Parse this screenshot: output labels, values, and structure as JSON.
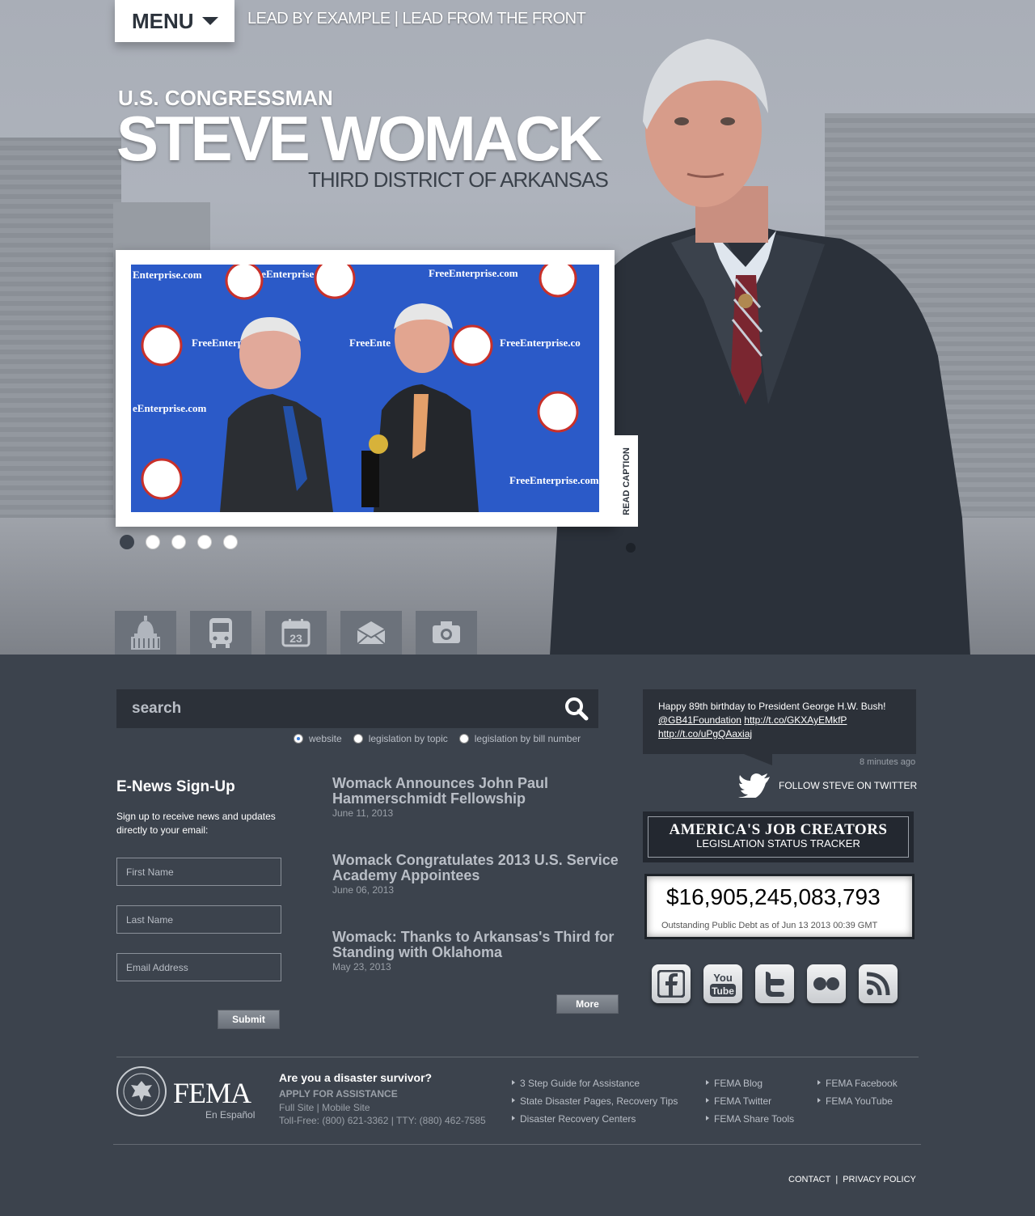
{
  "header": {
    "menu_label": "MENU",
    "tagline_left": "LEAD BY EXAMPLE",
    "tagline_sep": "|",
    "tagline_right": "LEAD FROM THE FRONT",
    "title_sub": "U.S. CONGRESSMAN",
    "title_name": "STEVE WOMACK",
    "title_district": "THIRD DISTRICT OF ARKANSAS"
  },
  "slideshow": {
    "caption_tab": "READ CAPTION",
    "backdrop_text": "FreeEnterprise.com",
    "dot_count": 5,
    "active_dot": 0
  },
  "quick_tabs": [
    {
      "icon": "capitol-icon"
    },
    {
      "icon": "bus-icon"
    },
    {
      "icon": "calendar-icon",
      "day": "23"
    },
    {
      "icon": "mail-icon"
    },
    {
      "icon": "camera-icon"
    }
  ],
  "search": {
    "placeholder": "search",
    "options": [
      "website",
      "legislation by topic",
      "legislation by bill number"
    ],
    "selected": "website"
  },
  "enews": {
    "title": "E-News Sign-Up",
    "description": "Sign up to receive news and updates directly to your email:",
    "first_name_placeholder": "First Name",
    "last_name_placeholder": "Last Name",
    "email_placeholder": "Email Address",
    "submit_label": "Submit"
  },
  "news": {
    "items": [
      {
        "title": "Womack Announces John Paul Hammerschmidt Fellowship",
        "date": "June 11, 2013"
      },
      {
        "title": "Womack Congratulates 2013 U.S. Service Academy Appointees",
        "date": "June 06, 2013"
      },
      {
        "title": "Womack: Thanks to Arkansas's Third for Standing with Oklahoma",
        "date": "May 23, 2013"
      }
    ],
    "more_label": "More"
  },
  "twitter": {
    "tweet_text": "Happy 89th birthday to President George H.W. Bush!",
    "mention": "@GB41Foundation",
    "link1": "http://t.co/GKXAyEMkfP",
    "link2": "http://t.co/uPgQAaxiaj",
    "time": "8 minutes ago",
    "follow_label": "FOLLOW STEVE ON TWITTER"
  },
  "jobs_banner": {
    "line1": "AMERICA'S JOB CREATORS",
    "line2": "LEGISLATION STATUS TRACKER"
  },
  "debt": {
    "value": "$16,905,245,083,793",
    "label": "Outstanding Public Debt as of Jun 13 2013 00:39 GMT"
  },
  "social": [
    "facebook-icon",
    "youtube-icon",
    "twitter-icon",
    "flickr-icon",
    "rss-icon"
  ],
  "fema": {
    "logo": "FEMA",
    "espanol": "En Español",
    "question": "Are you a disaster survivor?",
    "apply": "APPLY FOR ASSISTANCE",
    "sites": "Full Site | Mobile Site",
    "phone": "Toll-Free: (800) 621-3362 | TTY: (880) 462-7585",
    "col1": [
      "3 Step Guide for Assistance",
      "State Disaster Pages, Recovery Tips",
      "Disaster Recovery Centers"
    ],
    "col2": [
      "FEMA Blog",
      "FEMA Twitter",
      "FEMA Share Tools"
    ],
    "col3": [
      "FEMA Facebook",
      "FEMA YouTube"
    ]
  },
  "footer": {
    "contact": "CONTACT",
    "sep": "|",
    "privacy": "PRIVACY POLICY"
  }
}
